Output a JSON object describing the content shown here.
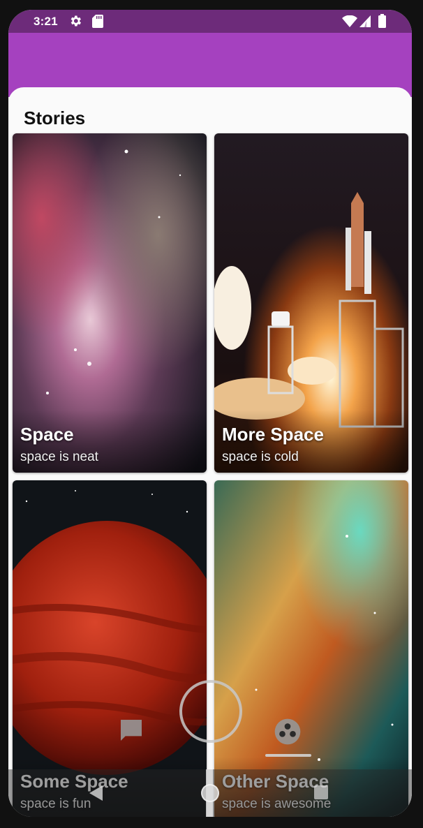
{
  "status_bar": {
    "time": "3:21",
    "icons": [
      "gear-icon",
      "sd-card-icon",
      "wifi-icon",
      "cell-signal-icon",
      "battery-icon"
    ],
    "color": "#6d2b7a"
  },
  "app_bar": {
    "color": "#a541bf"
  },
  "sheet": {
    "title": "Stories"
  },
  "stories": [
    {
      "title": "Space",
      "subtitle": "space is neat",
      "image": "nebula"
    },
    {
      "title": "More Space",
      "subtitle": "space is cold",
      "image": "shuttle-launch"
    },
    {
      "title": "Some Space",
      "subtitle": "space is fun",
      "image": "red-planet"
    },
    {
      "title": "Other Space",
      "subtitle": "space is awesome",
      "image": "galaxy-dust"
    }
  ],
  "bottom_overlay": {
    "icons": [
      "chat-icon",
      "circle-icon",
      "group-icon"
    ]
  },
  "nav_bar": {
    "icons": [
      "back-icon",
      "home-icon",
      "recents-icon"
    ]
  }
}
